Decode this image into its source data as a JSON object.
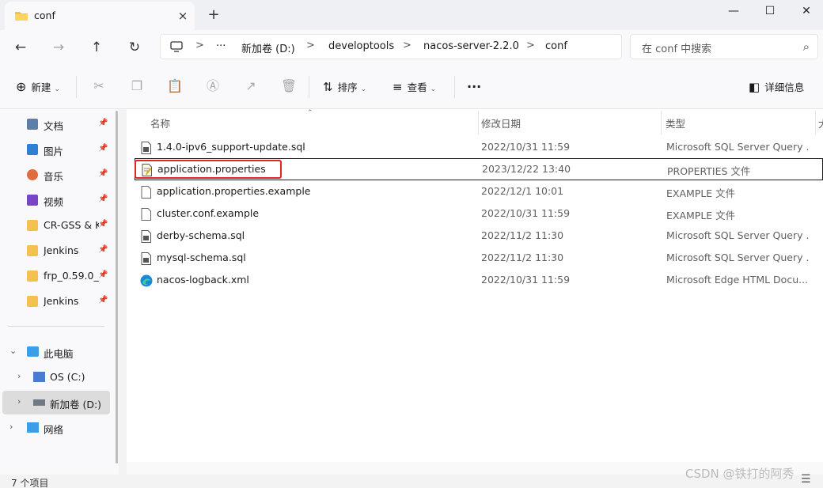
{
  "window": {
    "tab_title": "conf",
    "tab_close_icon": "×",
    "new_tab_icon": "+",
    "minimize_icon": "—",
    "maximize_icon": "☐",
    "close_icon": "✕"
  },
  "nav": {
    "back_icon": "←",
    "forward_icon": "→",
    "up_icon": "↑",
    "refresh_icon": "↻"
  },
  "address": {
    "computer_icon": "▭",
    "overflow": "···",
    "crumbs": [
      "新加卷 (D:)",
      "developtools",
      "nacos-server-2.2.0",
      "conf"
    ],
    "separator": ">"
  },
  "search": {
    "placeholder": "在 conf 中搜索",
    "icon": "⌕"
  },
  "toolbar": {
    "new_label": "新建",
    "new_icon": "⊕",
    "sort_label": "排序",
    "sort_icon": "⇅",
    "view_label": "查看",
    "view_icon": "≡",
    "more_label": "···",
    "details_label": "详细信息",
    "details_icon": "◧",
    "caret": "⌄"
  },
  "sidebar": {
    "pin_icon": "📌",
    "quick_access": [
      {
        "label": "文档",
        "color": "#5b7fa6"
      },
      {
        "label": "图片",
        "color": "#2f7fd4"
      },
      {
        "label": "音乐",
        "color": "#e26a3f"
      },
      {
        "label": "视频",
        "color": "#7a45c4"
      },
      {
        "label": "CR-GSS & K",
        "color": "#f2c14e"
      },
      {
        "label": "Jenkins",
        "color": "#f2c14e"
      },
      {
        "label": "frp_0.59.0_w",
        "color": "#f2c14e"
      },
      {
        "label": "Jenkins",
        "color": "#f2c14e"
      }
    ],
    "tree": [
      {
        "label": "此电脑",
        "chevron": "⌄",
        "color": "#3a9ee8"
      },
      {
        "label": "OS (C:)",
        "chevron": "›",
        "color": "#4a7bd0"
      },
      {
        "label": "新加卷 (D:)",
        "chevron": "›",
        "color": "#6f7a86"
      },
      {
        "label": "网络",
        "chevron": "›",
        "color": "#3a9ee8"
      }
    ]
  },
  "columns": {
    "name": "名称",
    "modified": "修改日期",
    "type": "类型",
    "size": "大"
  },
  "files": [
    {
      "name": "1.4.0-ipv6_support-update.sql",
      "date": "2022/10/31 11:59",
      "type": "Microsoft SQL Server Query ...",
      "icon": "sql"
    },
    {
      "name": "application.properties",
      "date": "2023/12/22 13:40",
      "type": "PROPERTIES 文件",
      "icon": "props"
    },
    {
      "name": "application.properties.example",
      "date": "2022/12/1 10:01",
      "type": "EXAMPLE 文件",
      "icon": "blank"
    },
    {
      "name": "cluster.conf.example",
      "date": "2022/10/31 11:59",
      "type": "EXAMPLE 文件",
      "icon": "blank"
    },
    {
      "name": "derby-schema.sql",
      "date": "2022/11/2 11:30",
      "type": "Microsoft SQL Server Query ...",
      "icon": "sql"
    },
    {
      "name": "mysql-schema.sql",
      "date": "2022/11/2 11:30",
      "type": "Microsoft SQL Server Query ...",
      "icon": "sql"
    },
    {
      "name": "nacos-logback.xml",
      "date": "2022/10/31 11:59",
      "type": "Microsoft Edge HTML Docu...",
      "icon": "edge"
    }
  ],
  "status": {
    "item_count": "7 个项目",
    "watermark": "CSDN @铁打的阿秀"
  }
}
